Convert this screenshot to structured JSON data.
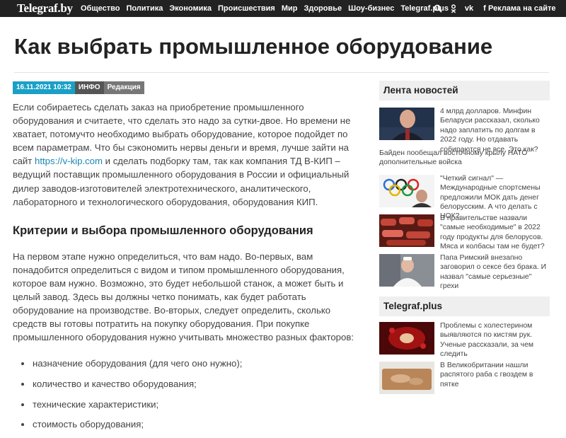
{
  "header": {
    "logo": "Telegraf.by",
    "nav": [
      "Общество",
      "Политика",
      "Экономика",
      "Происшествия",
      "Мир",
      "Здоровье",
      "Шоу-бизнес",
      "Telegraf.plus"
    ],
    "icons": [
      "search-icon",
      "odnoklassniki-icon",
      "vk-icon",
      "facebook-icon"
    ],
    "ad_link": "Реклама на сайте"
  },
  "article": {
    "title": "Как выбрать промышленное оборудование",
    "meta": {
      "date": "16.11.2021 10:32",
      "category": "ИНФО",
      "author": "Редакция"
    },
    "intro_before_link": "Если собираетесь сделать заказ на приобретение промышленного оборудования и считаете, что сделать это надо за сутки-двое. Но времени не хватает, потомучто необходимо выбрать оборудование, которое подойдет по всем параметрам. Что бы сэкономить нервы деньги и время, лучше зайти на сайт ",
    "intro_link": "https://v-kip.com",
    "intro_after_link": " и сделать подборку там, так как компания ТД В-КИП – ведущий поставщик промышленного оборудования в России и официальный дилер заводов-изготовителей электротехнического, аналитического, лабораторного и технологического оборудования, оборудования КИП.",
    "subheading": "Критерии и выбора промышленного оборудования",
    "paragraph2": "На первом этапе нужно определиться, что вам надо. Во-первых, вам понадобится определиться с видом и типом промышленного оборудования, которое вам нужно. Возможно, это будет небольшой станок, а может быть и целый завод. Здесь вы должны четко понимать, как будет работать оборудование на производстве. Во-вторых, следует определить, сколько средств вы готовы потратить на покупку оборудования. При покупке промышленного оборудования нужно учитывать множество разных факторов:",
    "list": [
      "назначение оборудования (для чего оно нужно);",
      "количество и качество оборудования;",
      "технические характеристики;",
      "стоимость оборудования;"
    ]
  },
  "sidebar": {
    "feed_title": "Лента новостей",
    "feed": [
      {
        "text": "4 млрд долларов. Минфин Беларуси рассказал, сколько надо заплатить по долгам в 2022 году. Но отдавать собираются не все. Это как?"
      },
      {
        "text": "Байден пообещал восточному крылу НАТО дополнительные войска",
        "plain": true
      },
      {
        "text": "\"Четкий сигнал\" — Международные спортсмены предложили МОК дать денег белорусским. А что делать с НОК?"
      },
      {
        "text": "В правительстве назвали \"самые необходимые\" в 2022 году продукты для белорусов. Мяса и колбасы там не будет?"
      },
      {
        "text": "Папа Римский внезапно заговорил о сексе без брака. И назвал \"самые серьезные\" грехи"
      }
    ],
    "plus_title": "Telegraf.plus",
    "plus": [
      {
        "text": "Проблемы с холестерином выявляются по кистям рук. Ученые рассказали, за чем следить"
      },
      {
        "text": "В Великобритании нашли распятого раба с гвоздем в пятке"
      }
    ]
  },
  "colors": {
    "topbar": "#222222",
    "accent": "#1aa0c8",
    "link": "#1a86b5"
  }
}
